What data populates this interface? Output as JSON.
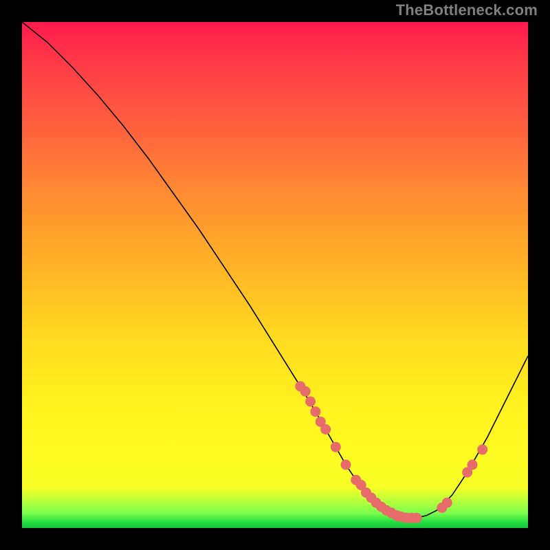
{
  "watermark": "TheBottleneck.com",
  "chart_data": {
    "type": "line",
    "title": "",
    "xlabel": "",
    "ylabel": "",
    "xlim": [
      0,
      100
    ],
    "ylim": [
      0,
      100
    ],
    "grid": false,
    "legend": false,
    "series": [
      {
        "name": "bottleneck-curve",
        "x": [
          0,
          5,
          10,
          15,
          20,
          25,
          30,
          35,
          40,
          45,
          50,
          55,
          58,
          60,
          62,
          64,
          66,
          68,
          70,
          72,
          74,
          76,
          78,
          80,
          82,
          85,
          88,
          92,
          96,
          100
        ],
        "y": [
          100,
          96,
          91,
          85.5,
          79.5,
          73,
          66,
          59,
          51.5,
          44,
          36,
          28,
          23,
          19.5,
          16,
          12.5,
          9.5,
          7,
          5,
          3.5,
          2.5,
          2,
          2,
          2.5,
          3.5,
          6.5,
          11,
          18,
          26,
          34
        ]
      }
    ],
    "points": {
      "name": "highlighted-samples",
      "x": [
        55,
        56,
        57,
        58,
        59,
        60,
        62,
        64,
        66,
        67,
        68,
        69,
        70,
        71,
        72,
        73,
        74,
        74.5,
        75,
        76,
        77,
        78,
        83,
        84,
        88,
        89,
        91
      ],
      "y": [
        28,
        27,
        25,
        23,
        21,
        19.5,
        16,
        12.5,
        9.5,
        8.5,
        7,
        6,
        5,
        4.2,
        3.5,
        3,
        2.5,
        2.3,
        2.2,
        2,
        2,
        2,
        4,
        5,
        11,
        12.5,
        15.5
      ]
    },
    "gradient_colors": [
      "#ff1a4d",
      "#ff8833",
      "#ffd91f",
      "#1fd93f"
    ]
  }
}
